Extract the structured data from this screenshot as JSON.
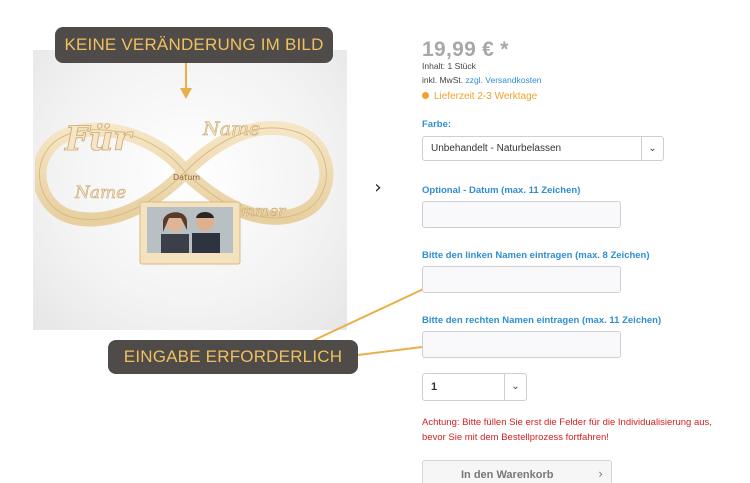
{
  "callouts": {
    "top": "KEINE VERÄNDERUNG IM BILD",
    "bottom": "EINGABE ERFORDERLICH"
  },
  "product_image": {
    "engraving_left": "Für",
    "engraving_name_left": "Name",
    "engraving_name_right": "Name",
    "engraving_date": "Datum",
    "engraving_forever": "Immer"
  },
  "price": "19,99 € *",
  "content": "Inhalt: 1 Stück",
  "tax": {
    "prefix": "inkl. MwSt. ",
    "link": "zzgl. Versandkosten"
  },
  "delivery": "Lieferzeit 2-3 Werktage",
  "fields": {
    "farbe_label": "Farbe:",
    "farbe_value": "Unbehandelt - Naturbelassen",
    "datum_label": "Optional - Datum (max. 11 Zeichen)",
    "datum_value": "",
    "links_label": "Bitte den linken Namen eintragen (max. 8 Zeichen)",
    "links_value": "",
    "rechts_label": "Bitte den rechten Namen eintragen (max. 11 Zeichen)",
    "rechts_value": ""
  },
  "quantity": "1",
  "warning": "Achtung: Bitte füllen Sie erst die Felder für die Individualisierung aus, bevor Sie mit dem Bestellprozess fortfahren!",
  "cart_button": "In den Warenkorb",
  "icons": {
    "next": "chevron-right-icon",
    "select": "chevron-down-icon",
    "cart": "chevron-right-icon"
  },
  "colors": {
    "accent": "#2f8fd0",
    "delivery": "#f0a32b",
    "warning": "#d62020",
    "callout_bg": "#4f4b48",
    "callout_text": "#f0c060",
    "arrow": "#e8b04a",
    "wood": "#f2dfba"
  }
}
